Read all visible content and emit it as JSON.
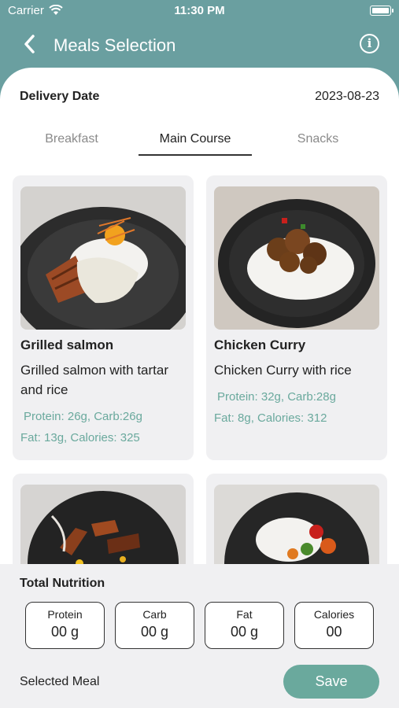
{
  "status_bar": {
    "carrier": "Carrier",
    "time": "11:30 PM"
  },
  "header": {
    "title": "Meals Selection",
    "back_icon": "chevron-left-icon",
    "info_icon": "info-icon"
  },
  "delivery": {
    "label": "Delivery Date",
    "date": "2023-08-23"
  },
  "tabs": [
    {
      "label": "Breakfast",
      "active": false
    },
    {
      "label": "Main Course",
      "active": true
    },
    {
      "label": "Snacks",
      "active": false
    }
  ],
  "meals": [
    {
      "name": "Grilled salmon",
      "description": "Grilled salmon with tartar and rice",
      "macros_line1": "Protein: 26g, Carb:26g",
      "macros_line2": "Fat: 13g, Calories: 325"
    },
    {
      "name": "Chicken Curry",
      "description": "Chicken Curry with rice",
      "macros_line1": "Protein: 32g, Carb:28g",
      "macros_line2": "Fat: 8g, Calories: 312"
    }
  ],
  "total_nutrition": {
    "title": "Total Nutrition",
    "items": [
      {
        "label": "Protein",
        "value": "00 g"
      },
      {
        "label": "Carb",
        "value": "00 g"
      },
      {
        "label": "Fat",
        "value": "00 g"
      },
      {
        "label": "Calories",
        "value": "00"
      }
    ]
  },
  "footer": {
    "selected_label": "Selected Meal",
    "save_label": "Save"
  },
  "colors": {
    "header_teal": "#6a9fa0",
    "accent_green": "#6aa99d",
    "card_bg": "#f0f0f2"
  }
}
